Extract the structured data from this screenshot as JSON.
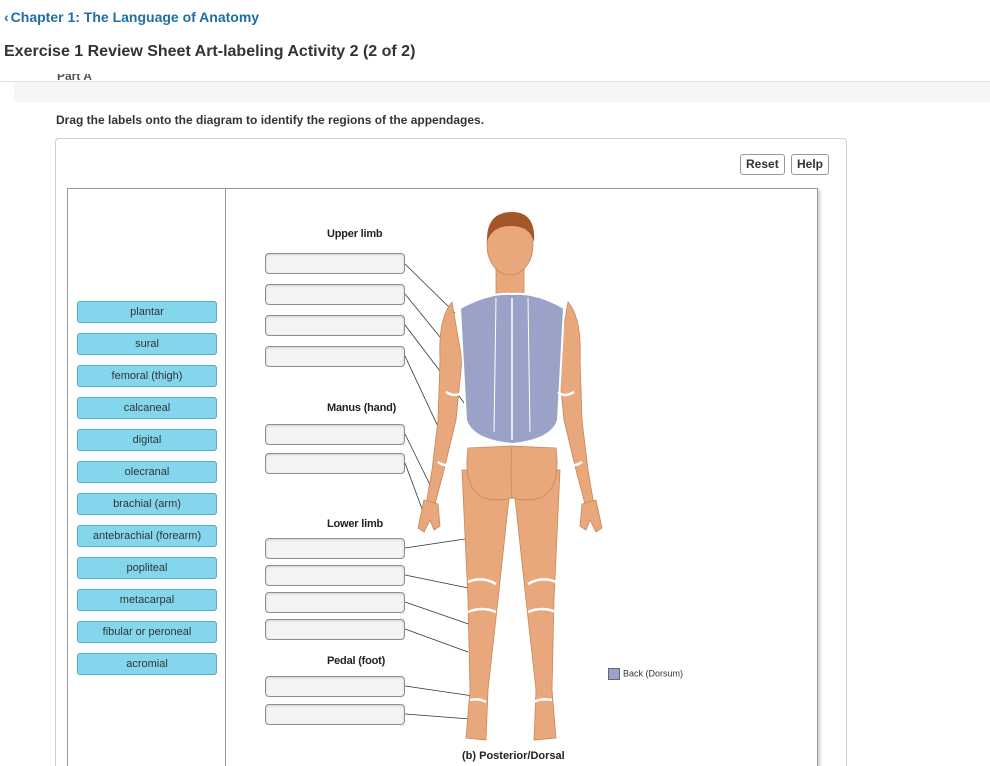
{
  "header": {
    "back_link": "Chapter 1: The Language of Anatomy",
    "exercise_title": "Exercise 1 Review Sheet Art-labeling Activity 2 (2 of 2)"
  },
  "instruction": "Drag the labels onto the diagram to identify the regions of the appendages.",
  "toolbar": {
    "reset_label": "Reset",
    "help_label": "Help"
  },
  "labels": [
    "plantar",
    "sural",
    "femoral (thigh)",
    "calcaneal",
    "digital",
    "olecranal",
    "brachial (arm)",
    "antebrachial (forearm)",
    "popliteal",
    "metacarpal",
    "fibular or peroneal",
    "acromial"
  ],
  "groups": {
    "upper_limb": "Upper limb",
    "manus": "Manus (hand)",
    "lower_limb": "Lower limb",
    "pedal": "Pedal (foot)"
  },
  "legend": {
    "label": "Back (Dorsum)",
    "color": "#9aa3c7"
  },
  "figure_caption": "(b) Posterior/Dorsal",
  "colors": {
    "chip_fill": "#84d6ec",
    "link": "#1f6fa3",
    "skin": "#e8a87c",
    "hair": "#a4552a"
  }
}
